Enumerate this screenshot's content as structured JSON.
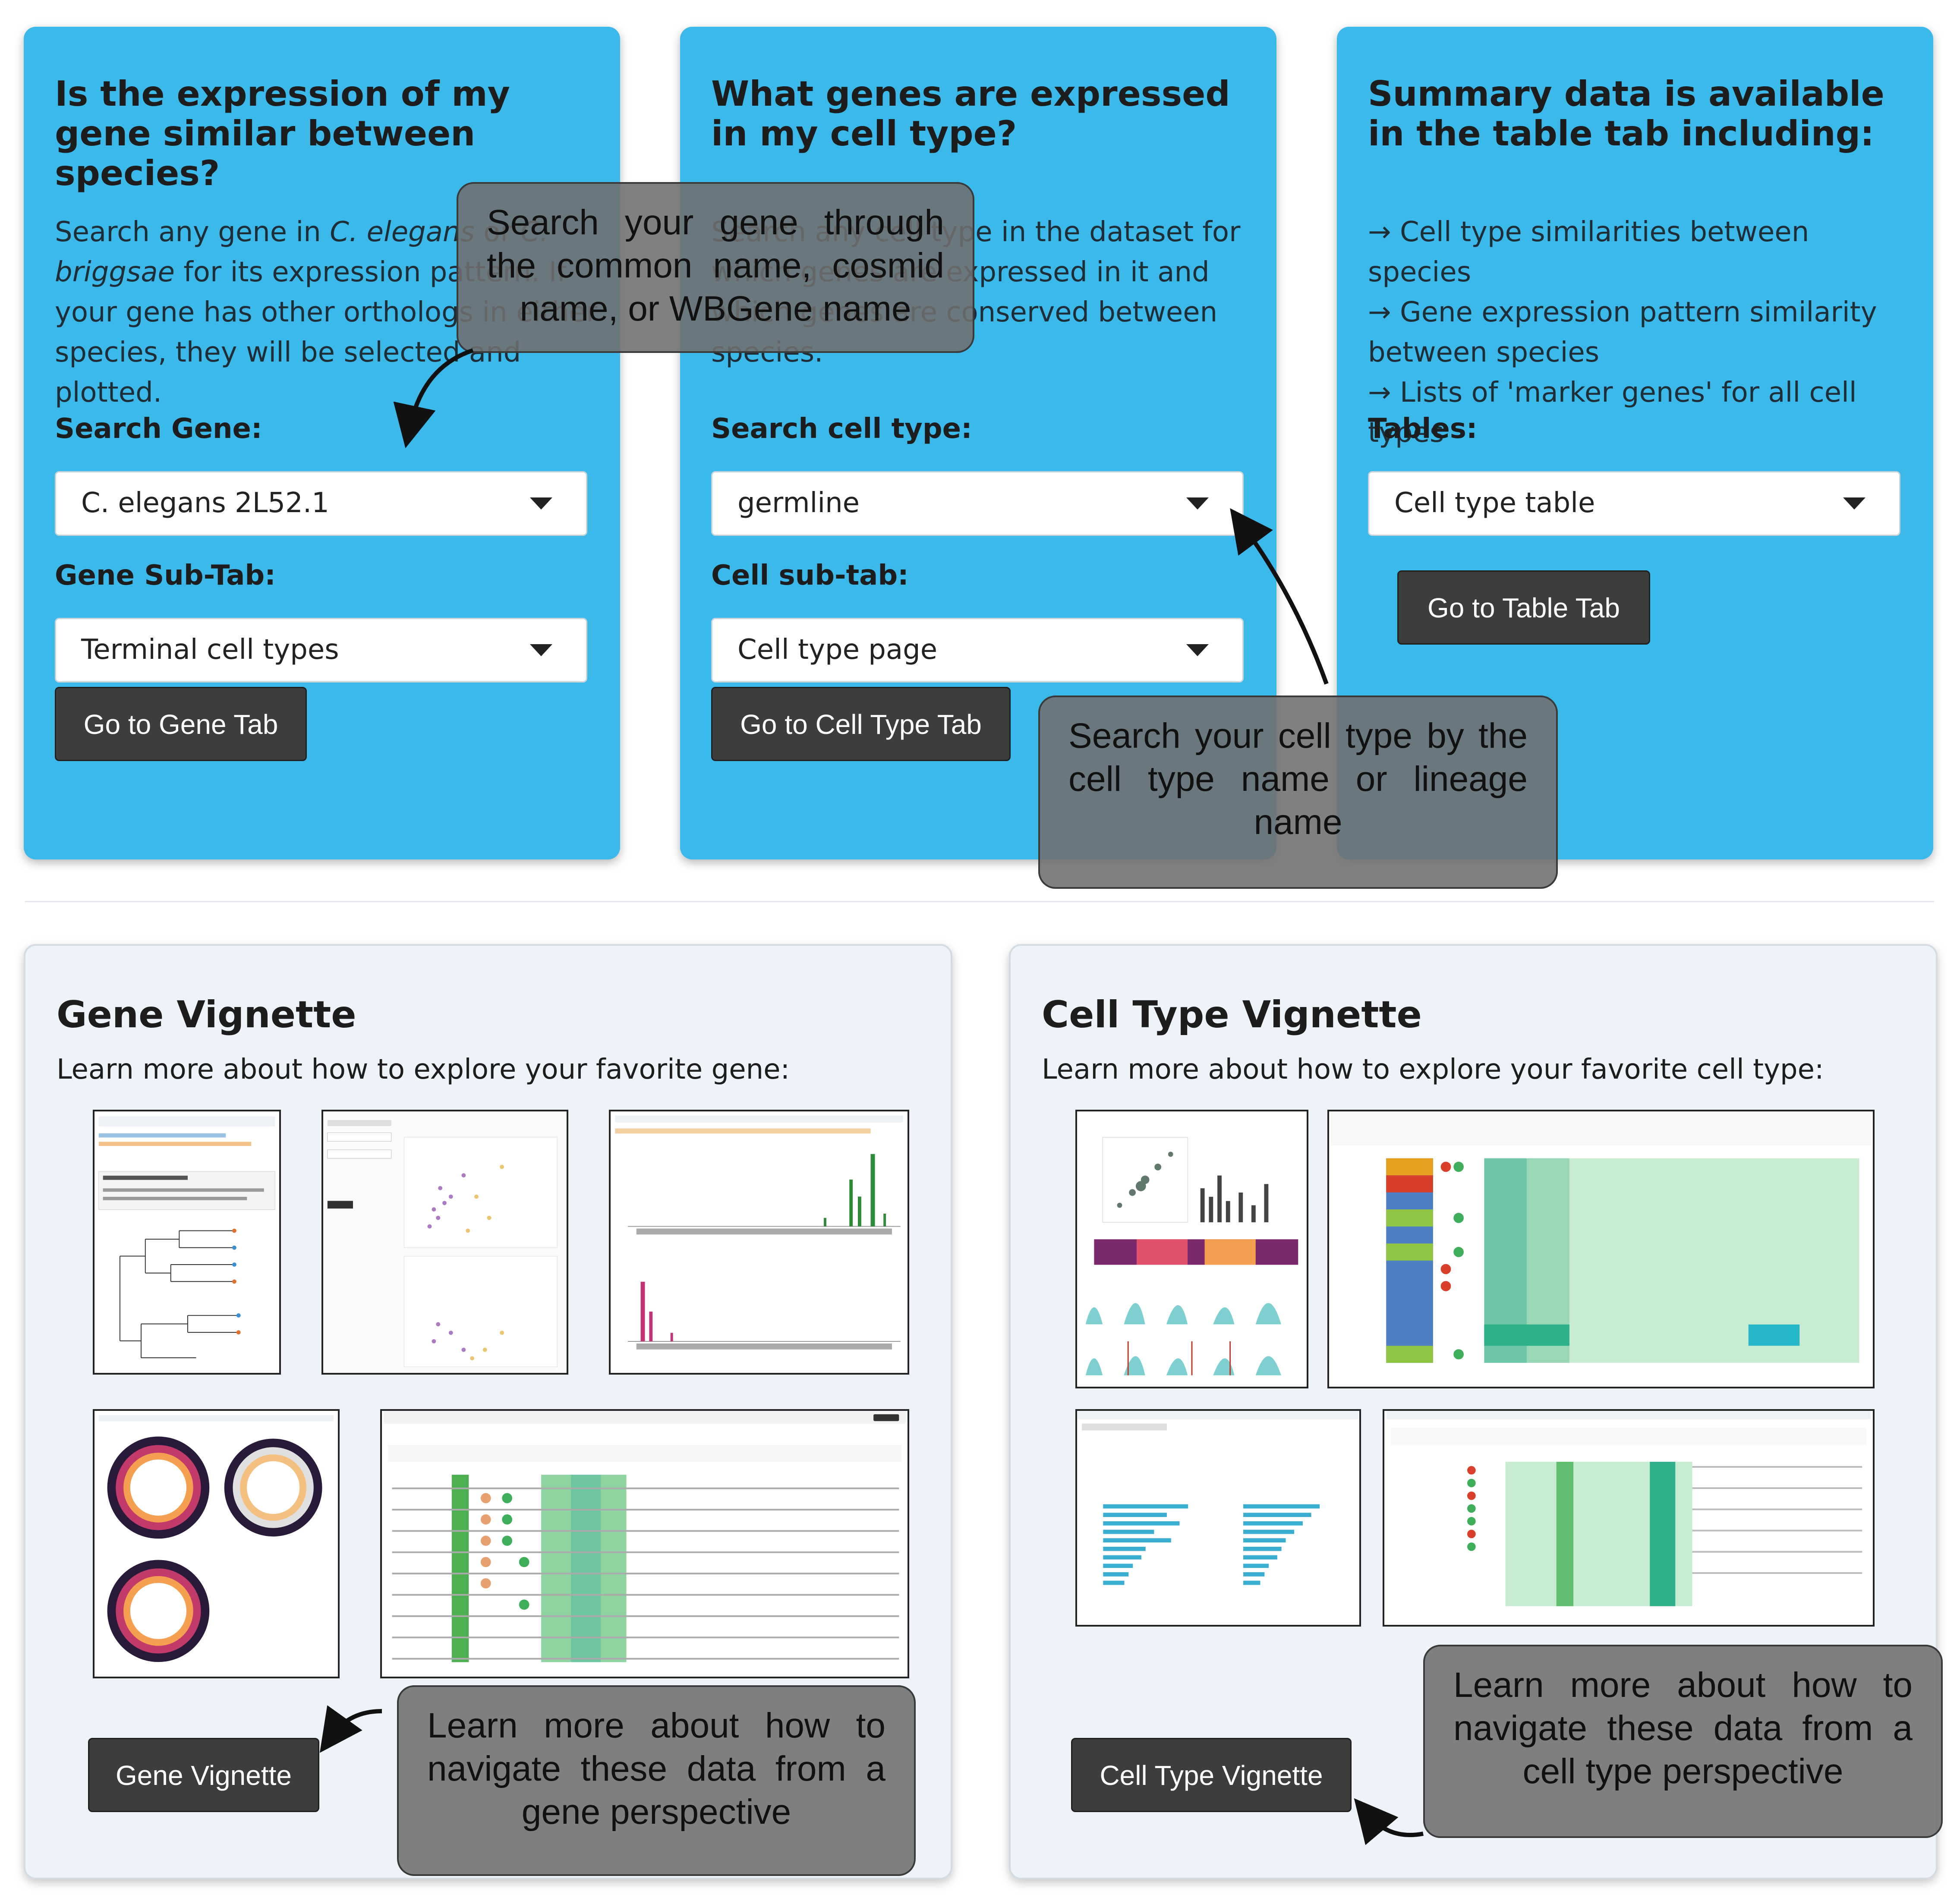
{
  "gene_card": {
    "title": "Is the expression of my gene similar between species?",
    "desc_1": "Search any gene in ",
    "desc_species_1": "C. elegans",
    "desc_2": " or ",
    "desc_species_2": "C. briggsae",
    "desc_3": " for its expression pattern. If your gene has other orthologs in either species, they will be selected and plotted.",
    "search_label": "Search Gene:",
    "search_value": "C. elegans 2L52.1",
    "subtab_label": "Gene Sub-Tab:",
    "subtab_value": "Terminal cell types",
    "button": "Go to Gene Tab"
  },
  "cell_card": {
    "title": "What genes are expressed in my cell type?",
    "desc": "Search any cell type in the dataset for which genes are expressed in it and which genes are conserved between species.",
    "search_label": "Search cell type:",
    "search_value": "germline",
    "subtab_label": "Cell sub-tab:",
    "subtab_value": "Cell type page",
    "button": "Go to Cell Type Tab"
  },
  "table_card": {
    "title": "Summary data is available in the table tab including:",
    "items": [
      "→ Cell type similarities between species",
      "→ Gene expression pattern similarity between species",
      "→ Lists of 'marker genes' for all cell types"
    ],
    "tables_label": "Tables:",
    "tables_value": "Cell type table",
    "button": "Go to Table Tab"
  },
  "callouts": {
    "gene_search": "Search your gene through the common name, cosmid name, or WBGene name",
    "cell_search": "Search your cell type by the cell type name or lineage name",
    "gene_vignette": "Learn more about how to navigate these data from a gene perspective",
    "cell_vignette": "Learn more about how to navigate these data from a cell type perspective"
  },
  "gene_vignette": {
    "title": "Gene Vignette",
    "subtitle": "Learn more about how to explore your favorite gene:",
    "button": "Gene Vignette"
  },
  "cell_vignette": {
    "title": "Cell Type Vignette",
    "subtitle": "Learn more about how to explore your favorite cell type:",
    "button": "Cell Type Vignette"
  },
  "colors": {
    "card_blue": "#3bb9ea",
    "button_dark": "#3d3d3d",
    "callout_gray": "#6e6e6e",
    "vignette_bg": "#eef3fa"
  },
  "icons": [
    "dropdown-caret-icon",
    "curved-arrow-icon"
  ]
}
